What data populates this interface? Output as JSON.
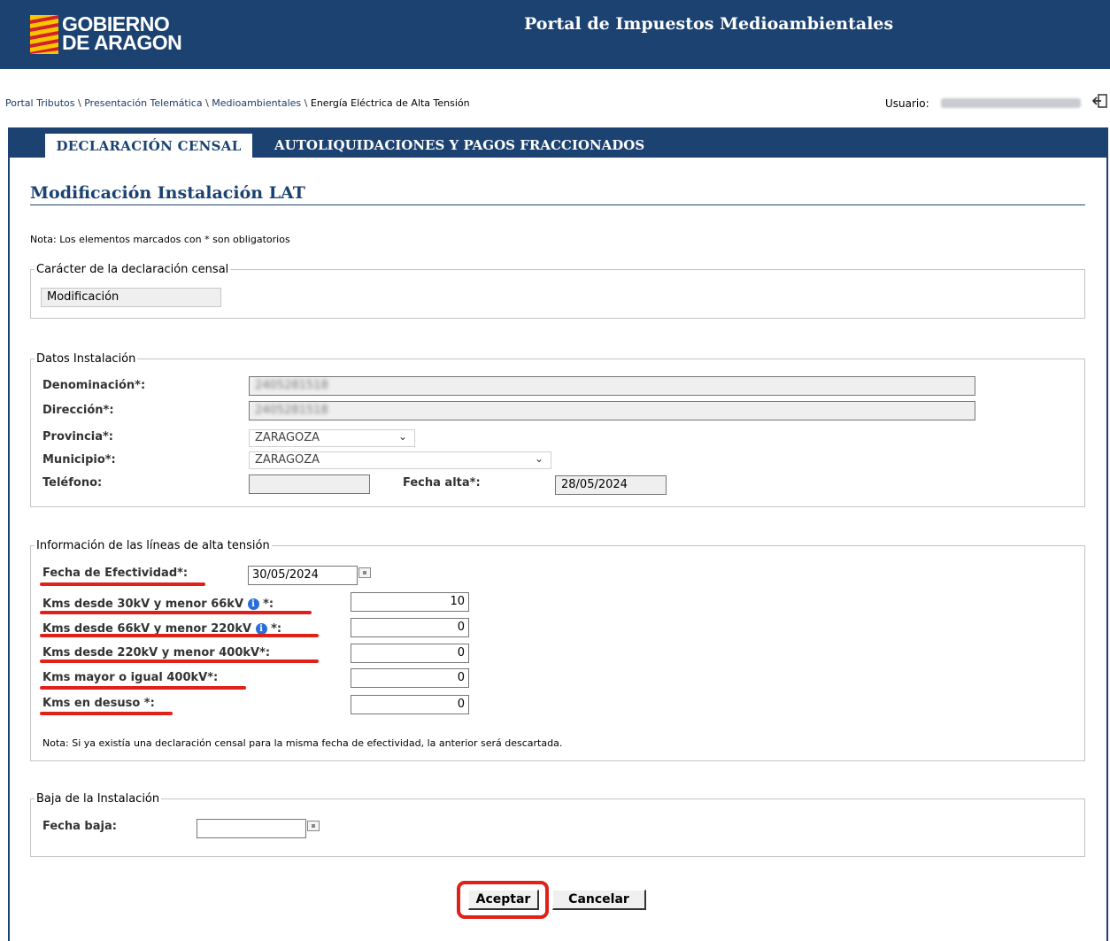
{
  "header": {
    "logo_line1": "GOBIERNO",
    "logo_line2": "DE ARAGON",
    "portal_title": "Portal de Impuestos Medioambientales",
    "bg_color": "#1b4271"
  },
  "breadcrumb": {
    "items": [
      "Portal Tributos",
      "Presentación Telemática",
      "Medioambientales",
      "Energía Eléctrica de Alta Tensión"
    ],
    "separator": " \\ "
  },
  "user": {
    "label": "Usuario:",
    "value": "",
    "logout_icon": "logout-icon"
  },
  "tabs": [
    {
      "label": "DECLARACIÓN CENSAL",
      "active": true
    },
    {
      "label": "AUTOLIQUIDACIONES Y PAGOS FRACCIONADOS",
      "active": false
    }
  ],
  "page": {
    "title": "Modificación Instalación LAT",
    "note_required": "Nota: Los elementos marcados con * son obligatorios"
  },
  "caracter": {
    "legend": "Carácter de la declaración censal",
    "value": "Modificación"
  },
  "datos": {
    "legend": "Datos Instalación",
    "denominacion_label": "Denominación*:",
    "denominacion_value": "2405281518",
    "direccion_label": "Dirección*:",
    "direccion_value": "2405281518",
    "provincia_label": "Provincia*:",
    "provincia_value": "ZARAGOZA",
    "municipio_label": "Municipio*:",
    "municipio_value": "ZARAGOZA",
    "telefono_label": "Teléfono:",
    "telefono_value": "",
    "fecha_alta_label": "Fecha alta*:",
    "fecha_alta_value": "28/05/2024"
  },
  "lineas": {
    "legend": "Información de las líneas de alta tensión",
    "fecha_efectividad_label": "Fecha de Efectividad*:",
    "fecha_efectividad_value": "30/05/2024",
    "km30_label": "Kms desde 30kV y menor 66kV",
    "km30_suffix": "*:",
    "km30_value": "10",
    "km66_label": "Kms desde 66kV y menor 220kV",
    "km66_suffix": "*:",
    "km66_value": "0",
    "km220_label": "Kms desde 220kV y menor 400kV*:",
    "km220_value": "0",
    "km400_label": "Kms mayor o igual 400kV*:",
    "km400_value": "0",
    "desuso_label": "Kms en desuso *:",
    "desuso_value": "0",
    "note": "Nota: Si ya existía una declaración censal para la misma fecha de efectividad, la anterior será descartada.",
    "highlight_color": "#e0211a"
  },
  "baja": {
    "legend": "Baja de la Instalación",
    "fecha_baja_label": "Fecha baja:",
    "fecha_baja_value": ""
  },
  "buttons": {
    "accept": "Aceptar",
    "cancel": "Cancelar"
  }
}
